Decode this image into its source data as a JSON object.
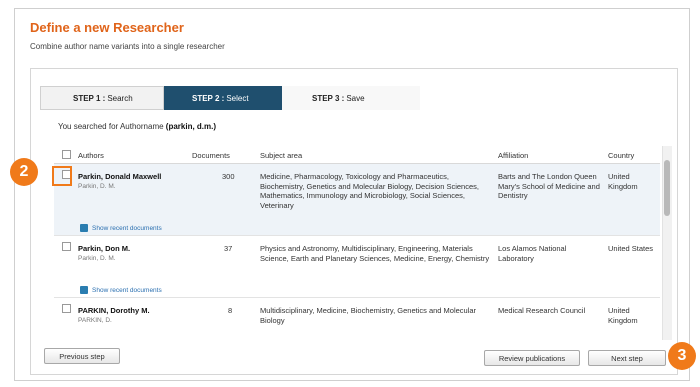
{
  "dialog": {
    "title": "Define a new Researcher",
    "subtitle": "Combine author name variants into a single researcher"
  },
  "stepper": {
    "step1": {
      "label": "STEP 1 :",
      "name": "Search"
    },
    "step2": {
      "label": "STEP 2 :",
      "name": "Select"
    },
    "step3": {
      "label": "STEP 3 :",
      "name": "Save"
    }
  },
  "search_summary": {
    "prefix": "You searched for Authorname",
    "query": "(parkin, d.m.)"
  },
  "table": {
    "headers": {
      "author": "Authors",
      "documents": "Documents",
      "subject": "Subject area",
      "affiliation": "Affiliation",
      "country": "Country"
    },
    "rows": [
      {
        "num": "1",
        "name": "Parkin, Donald Maxwell",
        "variant": "Parkin, D. M.",
        "documents": "300",
        "subject": "Medicine, Pharmacology, Toxicology and Pharmaceutics, Biochemistry, Genetics and Molecular Biology, Decision Sciences, Mathematics, Immunology and Microbiology, Social Sciences, Veterinary",
        "affiliation": "Barts and The London Queen Mary's School of Medicine and Dentistry",
        "country": "United Kingdom",
        "recent": "Show recent documents"
      },
      {
        "num": "2",
        "name": "Parkin, Don M.",
        "variant": "Parkin, D. M.",
        "documents": "37",
        "subject": "Physics and Astronomy, Multidisciplinary, Engineering, Materials Science, Earth and Planetary Sciences, Medicine, Energy, Chemistry",
        "affiliation": "Los Alamos National Laboratory",
        "country": "United States",
        "recent": "Show recent documents"
      },
      {
        "num": "3",
        "name": "PARKIN, Dorothy M.",
        "variant": "PARKIN, D.",
        "documents": "8",
        "subject": "Multidisciplinary, Medicine, Biochemistry, Genetics and Molecular Biology",
        "affiliation": "Medical Research Council",
        "country": "United Kingdom",
        "recent": ""
      }
    ]
  },
  "buttons": {
    "previous": "Previous step",
    "review": "Review publications",
    "next": "Next step"
  },
  "callouts": {
    "c2": "2",
    "c3": "3"
  },
  "colors": {
    "accent": "#e0641a",
    "stepper_active": "#1f4f6e",
    "callout": "#f07a1a",
    "link": "#2a6fb0"
  }
}
